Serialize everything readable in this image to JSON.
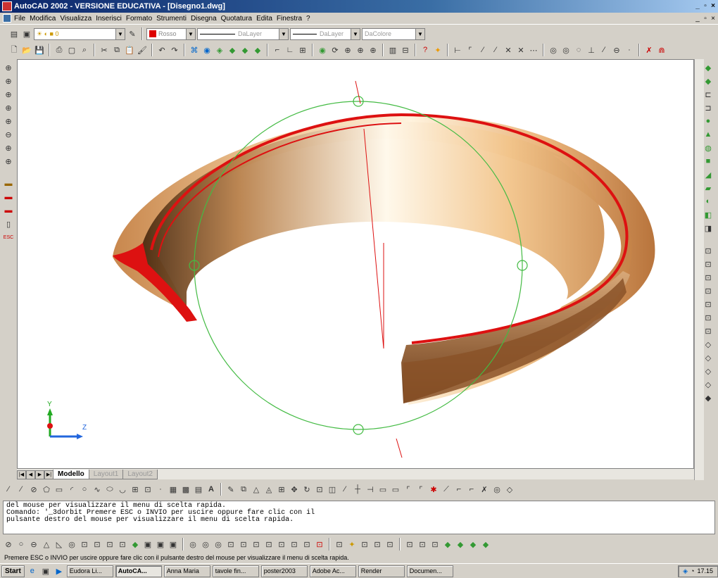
{
  "window": {
    "title": "AutoCAD 2002 - VERSIONE EDUCATIVA - [Disegno1.dwg]"
  },
  "menu": [
    "File",
    "Modifica",
    "Visualizza",
    "Inserisci",
    "Formato",
    "Strumenti",
    "Disegna",
    "Quotatura",
    "Edita",
    "Finestra",
    "?"
  ],
  "properties": {
    "color": "Rosso",
    "linetype": "DaLayer",
    "lineweight": "DaLayer",
    "plotstyle": "DaColore"
  },
  "tabs": [
    "Modello",
    "Layout1",
    "Layout2"
  ],
  "command_lines": [
    "del mouse per visualizzare il menu di scelta rapida.",
    "Comando: '_3dorbit Premere ESC o INVIO per uscire oppure fare clic con il",
    "pulsante destro del mouse per visualizzare il menu di scelta rapida."
  ],
  "status_text": "Premere ESC o INVIO per uscire oppure fare clic con il pulsante destro del mouse per visualizzare il menu di scelta rapida.",
  "taskbar": {
    "start": "Start",
    "items": [
      "Eudora Li...",
      "AutoCA...",
      "Anna Maria",
      "tavole fin...",
      "poster2003",
      "Adobe Ac...",
      "Render",
      "Documen..."
    ],
    "clock": "17.15"
  },
  "ucs": {
    "y": "Y",
    "z": "Z"
  },
  "colors": {
    "accent_red": "#dd1111",
    "orbit_green": "#44bb44",
    "vessel": "#e0a872"
  }
}
